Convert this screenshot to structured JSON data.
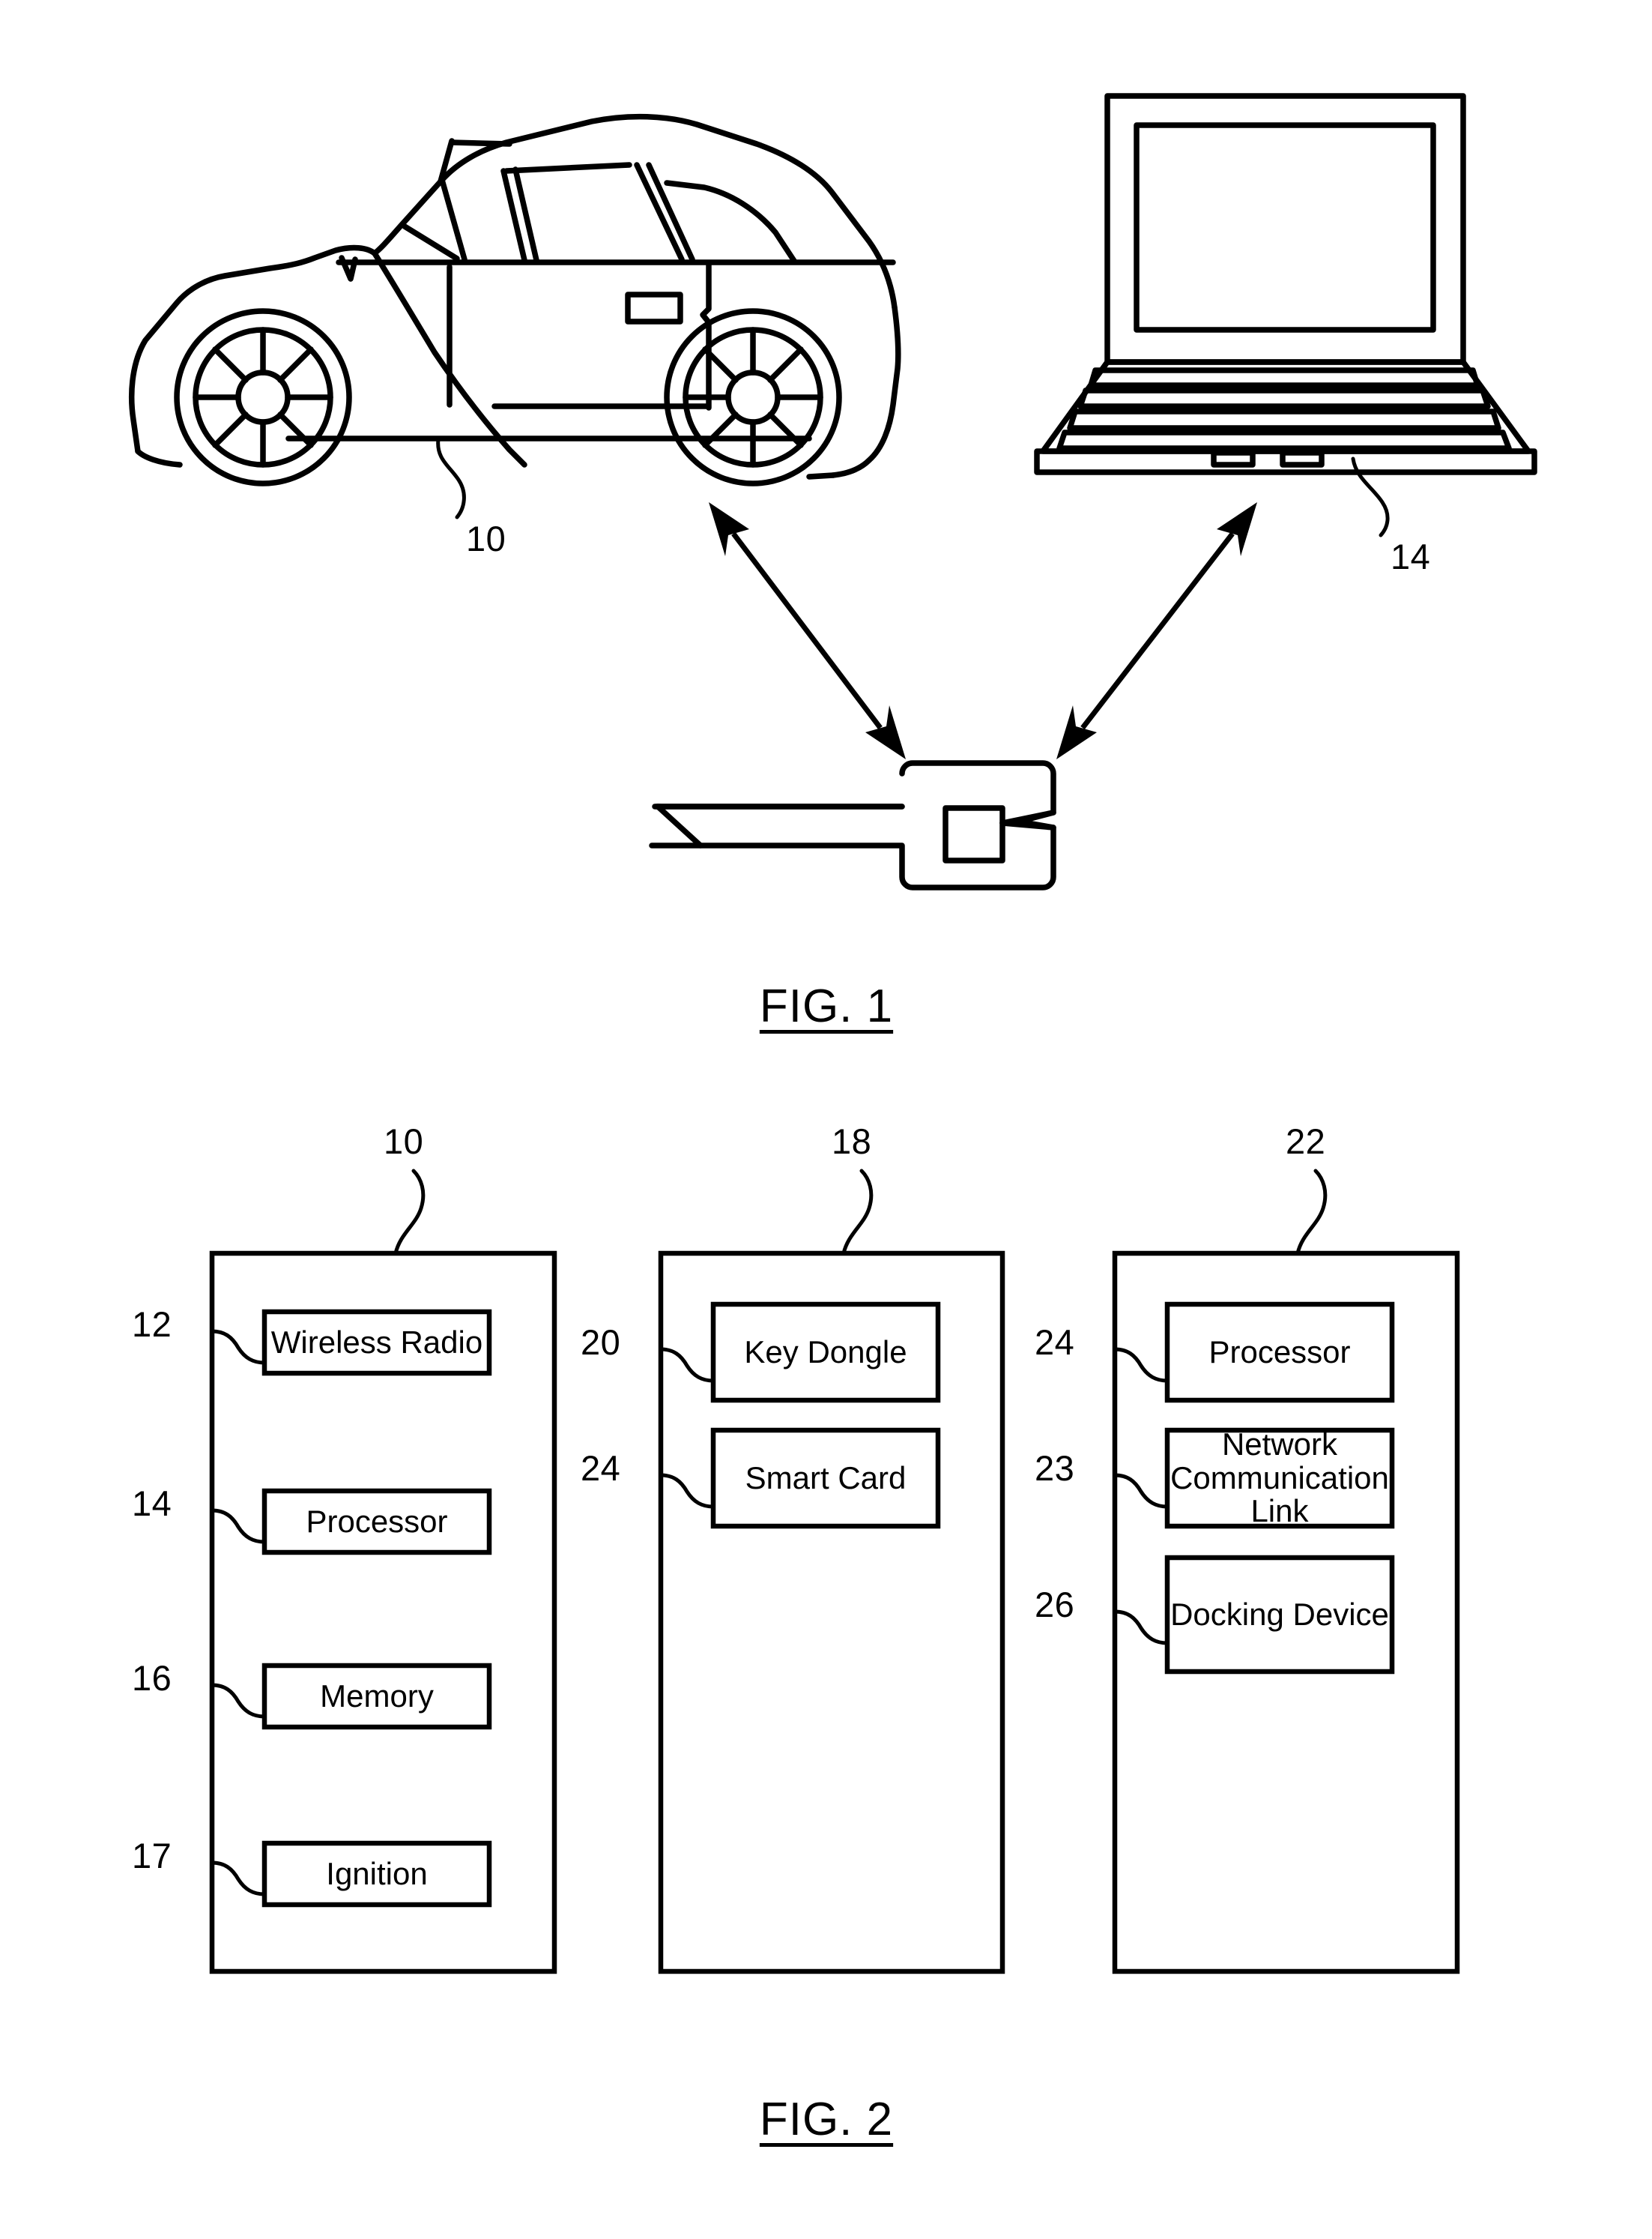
{
  "document": {
    "kind": "patent-drawing-sheet",
    "background_color": "#ffffff",
    "line_color": "#000000"
  },
  "figure1": {
    "caption": "FIG. 1",
    "reference_numerals": [
      {
        "id": "fig1-vehicle-ref",
        "value": "10",
        "points_to": "vehicle"
      },
      {
        "id": "fig1-laptop-ref",
        "value": "14",
        "points_to": "laptop"
      }
    ],
    "elements": [
      {
        "name": "vehicle-illustration",
        "label": "car side view"
      },
      {
        "name": "laptop-illustration",
        "label": "open laptop computer"
      },
      {
        "name": "key-dongle-illustration",
        "label": "key with dongle"
      }
    ],
    "arrows": [
      {
        "name": "vehicle-key-arrow",
        "style": "double-headed"
      },
      {
        "name": "laptop-key-arrow",
        "style": "double-headed"
      }
    ]
  },
  "figure2": {
    "caption": "FIG. 2",
    "columns": [
      {
        "name": "vehicle-block",
        "ref": "10",
        "items": [
          {
            "ref": "12",
            "label": "Wireless Radio"
          },
          {
            "ref": "14",
            "label": "Processor"
          },
          {
            "ref": "16",
            "label": "Memory"
          },
          {
            "ref": "17",
            "label": "Ignition"
          }
        ]
      },
      {
        "name": "key-block",
        "ref": "18",
        "items": [
          {
            "ref": "20",
            "label": "Key Dongle"
          },
          {
            "ref": "24",
            "label": "Smart Card"
          }
        ]
      },
      {
        "name": "computer-block",
        "ref": "22",
        "items": [
          {
            "ref": "24",
            "label": "Processor"
          },
          {
            "ref": "23",
            "label": "Network\nCommunication\nLink"
          },
          {
            "ref": "26",
            "label": "Docking Device"
          }
        ]
      }
    ]
  }
}
